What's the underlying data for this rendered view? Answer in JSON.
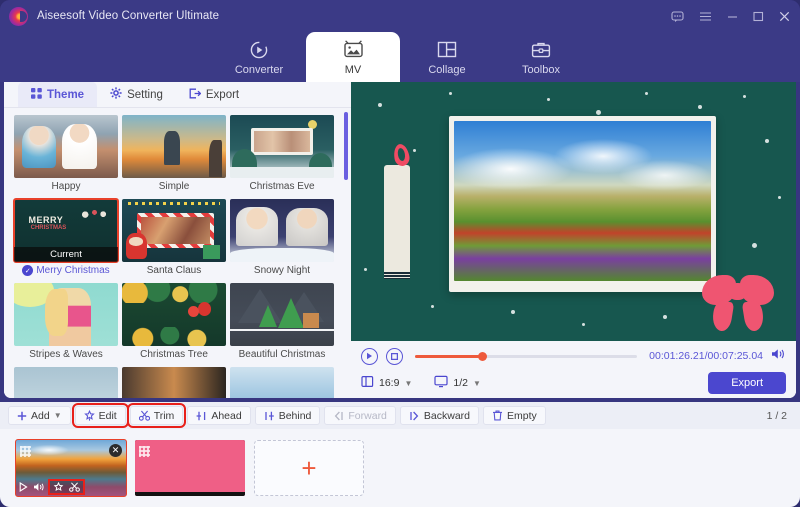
{
  "app": {
    "title": "Aiseesoft Video Converter Ultimate",
    "logo_icon": "aiseesoft-logo"
  },
  "window_controls": [
    {
      "name": "feedback-icon",
      "glyph": "▭"
    },
    {
      "name": "menu-icon",
      "glyph": "≡"
    },
    {
      "name": "minimize-icon",
      "glyph": "–"
    },
    {
      "name": "maximize-icon",
      "glyph": "□"
    },
    {
      "name": "close-icon",
      "glyph": "✕"
    }
  ],
  "nav_tabs": [
    {
      "label": "Converter",
      "icon": "converter-icon",
      "active": false
    },
    {
      "label": "MV",
      "icon": "mv-icon",
      "active": true
    },
    {
      "label": "Collage",
      "icon": "collage-icon",
      "active": false
    },
    {
      "label": "Toolbox",
      "icon": "toolbox-icon",
      "active": false
    }
  ],
  "sub_tabs": [
    {
      "label": "Theme",
      "icon": "grid-icon",
      "active": true
    },
    {
      "label": "Setting",
      "icon": "gear-icon",
      "active": false
    },
    {
      "label": "Export",
      "icon": "export-icon",
      "active": false
    }
  ],
  "themes": [
    {
      "label": "Happy",
      "selected": false,
      "current": false
    },
    {
      "label": "Simple",
      "selected": false,
      "current": false
    },
    {
      "label": "Christmas Eve",
      "selected": false,
      "current": false
    },
    {
      "label": "Merry Christmas",
      "selected": true,
      "current": true,
      "current_label": "Current"
    },
    {
      "label": "Santa Claus",
      "selected": false,
      "current": false
    },
    {
      "label": "Snowy Night",
      "selected": false,
      "current": false
    },
    {
      "label": "Stripes & Waves",
      "selected": false,
      "current": false
    },
    {
      "label": "Christmas Tree",
      "selected": false,
      "current": false
    },
    {
      "label": "Beautiful Christmas",
      "selected": false,
      "current": false
    }
  ],
  "player": {
    "play_icon": "play-icon",
    "stop_icon": "stop-icon",
    "progress_percent": 30,
    "time_display": "00:01:26.21/00:07:25.04",
    "volume_icon": "volume-icon",
    "aspect_ratio": "16:9",
    "aspect_icon": "aspect-ratio-icon",
    "zoom_level": "1/2",
    "screen_icon": "screen-icon",
    "export_label": "Export"
  },
  "toolbar": {
    "buttons": [
      {
        "label": "Add",
        "icon": "plus-icon",
        "dropdown": true,
        "disabled": false,
        "highlighted": false
      },
      {
        "label": "Edit",
        "icon": "edit-icon",
        "dropdown": false,
        "disabled": false,
        "highlighted": true
      },
      {
        "label": "Trim",
        "icon": "scissors-icon",
        "dropdown": false,
        "disabled": false,
        "highlighted": true
      },
      {
        "label": "Ahead",
        "icon": "ahead-icon",
        "dropdown": false,
        "disabled": false,
        "highlighted": false
      },
      {
        "label": "Behind",
        "icon": "behind-icon",
        "dropdown": false,
        "disabled": false,
        "highlighted": false
      },
      {
        "label": "Forward",
        "icon": "forward-icon",
        "dropdown": false,
        "disabled": true,
        "highlighted": false
      },
      {
        "label": "Backward",
        "icon": "backward-icon",
        "dropdown": false,
        "disabled": false,
        "highlighted": false
      },
      {
        "label": "Empty",
        "icon": "trash-icon",
        "dropdown": false,
        "disabled": false,
        "highlighted": false
      }
    ],
    "page_indicator": "1 / 2"
  },
  "timeline": {
    "clips": [
      {
        "name": "clip-landscape",
        "selected": true,
        "has_close": true,
        "tools": [
          {
            "name": "play-icon",
            "highlighted": false
          },
          {
            "name": "volume-icon",
            "highlighted": false
          },
          {
            "name": "edit-icon",
            "highlighted": true
          },
          {
            "name": "trim-icon",
            "highlighted": true
          }
        ]
      },
      {
        "name": "clip-pink",
        "selected": false,
        "has_close": false,
        "tools": []
      }
    ],
    "add_label": "+"
  },
  "colors": {
    "titlebar": "#3b3a86",
    "accent": "#5a56d6",
    "export_button": "#4b47cf",
    "highlight_red": "#e8201a",
    "progress": "#ee5a3c",
    "preview_bg": "#17574f"
  }
}
